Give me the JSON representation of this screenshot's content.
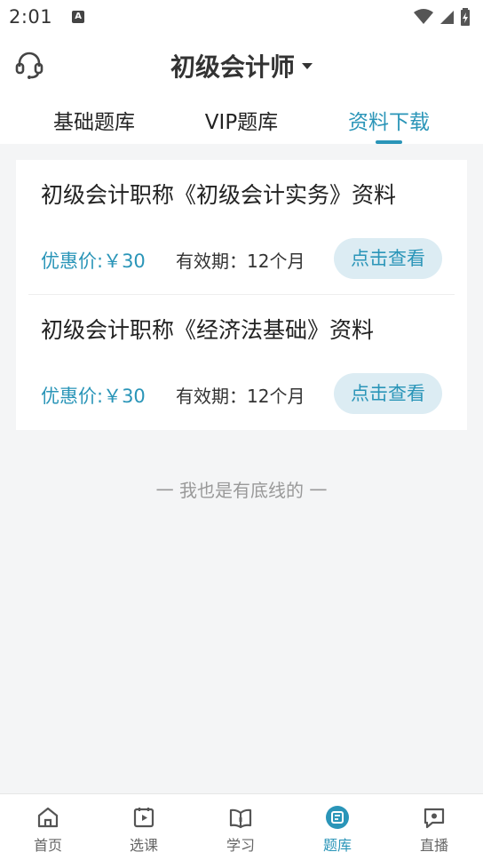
{
  "status_bar": {
    "time": "2:01",
    "notification_badge": "A"
  },
  "header": {
    "title": "初级会计师",
    "tabs": [
      {
        "label": "基础题库",
        "active": false
      },
      {
        "label": "VIP题库",
        "active": false
      },
      {
        "label": "资料下载",
        "active": true
      }
    ]
  },
  "materials": [
    {
      "name": "初级会计职称《初级会计实务》资料",
      "price": "优惠价:￥30",
      "validity": "有效期：12个月",
      "button_label": "点击查看"
    },
    {
      "name": "初级会计职称《经济法基础》资料",
      "price": "优惠价:￥30",
      "validity": "有效期：12个月",
      "button_label": "点击查看"
    }
  ],
  "end_text": "一  我也是有底线的  一",
  "bottom_nav": [
    {
      "label": "首页",
      "icon": "home-icon",
      "active": false
    },
    {
      "label": "选课",
      "icon": "course-icon",
      "active": false
    },
    {
      "label": "学习",
      "icon": "study-book-icon",
      "active": false
    },
    {
      "label": "题库",
      "icon": "question-bank-icon",
      "active": true
    },
    {
      "label": "直播",
      "icon": "live-icon",
      "active": false
    }
  ],
  "colors": {
    "accent": "#2a95b8",
    "button_bg": "#dcecf3",
    "page_bg": "#f4f5f6"
  }
}
